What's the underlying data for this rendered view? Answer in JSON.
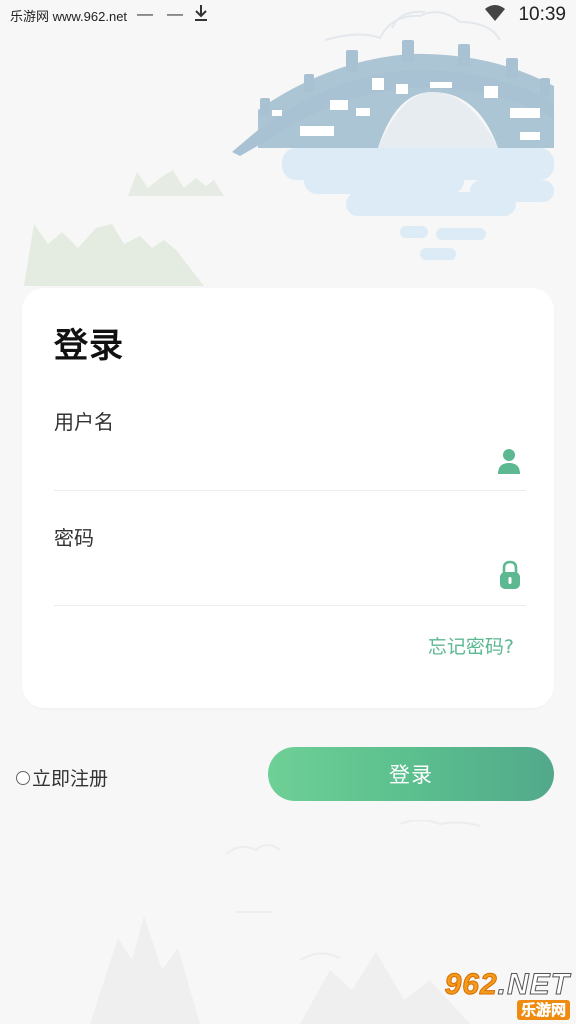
{
  "status_bar": {
    "site_text": "乐游网 www.962.net",
    "dash_1": "—",
    "dash_2": "—",
    "download_icon": "download-icon",
    "wifi_icon": "wifi-icon",
    "time": "10:39"
  },
  "login_card": {
    "title": "登录",
    "username": {
      "label": "用户名",
      "value": "",
      "placeholder": "",
      "icon": "person-icon"
    },
    "password": {
      "label": "密码",
      "value": "",
      "placeholder": "",
      "icon": "lock-icon"
    },
    "forgot_password": "忘记密码?"
  },
  "register": {
    "label": "立即注册",
    "checked": false
  },
  "login_button": {
    "label": "登录"
  },
  "watermark": {
    "number": "962",
    "suffix": ".NET",
    "name": "乐游网"
  },
  "colors": {
    "accent": "#5cb891",
    "button_gradient_start": "#6ed096",
    "button_gradient_end": "#52a98b",
    "bridge": "#a9c3d4",
    "water": "#d7e9f3",
    "mountains": "#e1e9df"
  }
}
